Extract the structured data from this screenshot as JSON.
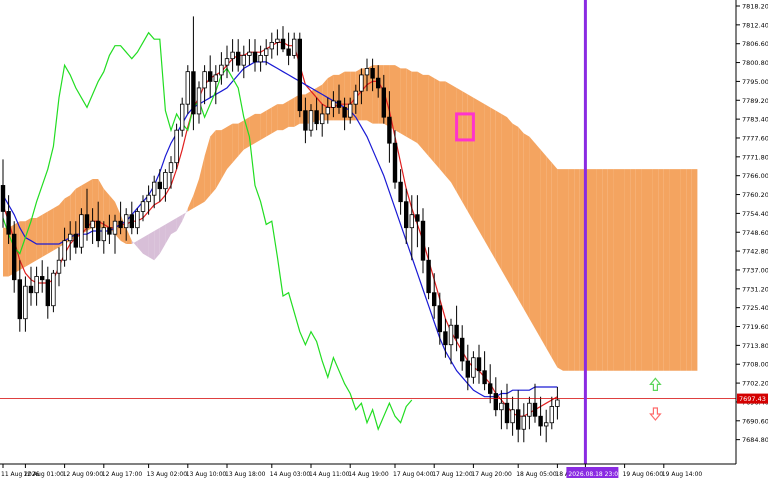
{
  "chart_data": {
    "type": "candlestick",
    "instrument_note": "",
    "y_axis": {
      "min": 7681.0,
      "max": 7818.2,
      "ticks": [
        "7818.20",
        "7812.40",
        "7806.60",
        "7800.80",
        "7795.00",
        "7789.20",
        "7783.40",
        "7777.60",
        "7771.80",
        "7766.00",
        "7760.20",
        "7754.40",
        "7748.60",
        "7742.80",
        "7737.00",
        "7731.20",
        "7725.40",
        "7719.60",
        "7713.80",
        "7708.00",
        "7702.20",
        "7696.40",
        "7690.60",
        "7684.80"
      ]
    },
    "x_axis": {
      "ticks": [
        {
          "label": "11 Aug 2026",
          "i": 0
        },
        {
          "label": "12 Aug 01:00",
          "i": 4
        },
        {
          "label": "12 Aug 09:00",
          "i": 11
        },
        {
          "label": "12 Aug 17:00",
          "i": 18
        },
        {
          "label": "13 Aug 02:00",
          "i": 26
        },
        {
          "label": "13 Aug 10:00",
          "i": 33
        },
        {
          "label": "13 Aug 18:00",
          "i": 40
        },
        {
          "label": "14 Aug 03:00",
          "i": 48
        },
        {
          "label": "14 Aug 11:00",
          "i": 55
        },
        {
          "label": "14 Aug 19:00",
          "i": 62
        },
        {
          "label": "17 Aug 04:00",
          "i": 70
        },
        {
          "label": "17 Aug 12:00",
          "i": 77
        },
        {
          "label": "17 Aug 20:00",
          "i": 84
        },
        {
          "label": "18 Aug 05:00",
          "i": 92
        },
        {
          "label": "18 Aug 13:00",
          "i": 99
        },
        {
          "label": "2026.08.18 23:00",
          "i": 104,
          "highlight": true
        },
        {
          "label": "19 Aug 06:00",
          "i": 111
        },
        {
          "label": "19 Aug 14:00",
          "i": 118
        }
      ]
    },
    "current_price": {
      "value": 7697.43,
      "label": "7697.43",
      "color": "#d40000"
    },
    "vertical_marker": {
      "i": 104,
      "color": "#8a2be2"
    },
    "highlight_box": {
      "i0": 81,
      "i1": 84,
      "y0": 7785.0,
      "y1": 7777.0,
      "color": "#ff33cc"
    },
    "arrows": [
      {
        "dir": "up",
        "i": 116.5,
        "y": 7701.5,
        "color": "#5cd65c"
      },
      {
        "dir": "down",
        "i": 116.5,
        "y": 7693.0,
        "color": "#ff6a6a"
      }
    ],
    "ohlc": [
      [
        7763,
        7771,
        7750,
        7755
      ],
      [
        7755,
        7760,
        7745,
        7748
      ],
      [
        7748,
        7752,
        7730,
        7734
      ],
      [
        7734,
        7740,
        7718,
        7722
      ],
      [
        7722,
        7735,
        7718,
        7732
      ],
      [
        7732,
        7738,
        7726,
        7730
      ],
      [
        7730,
        7738,
        7726,
        7735
      ],
      [
        7735,
        7740,
        7730,
        7734
      ],
      [
        7734,
        7738,
        7722,
        7726
      ],
      [
        7726,
        7737,
        7724,
        7736
      ],
      [
        7736,
        7744,
        7732,
        7740
      ],
      [
        7740,
        7750,
        7738,
        7746
      ],
      [
        7746,
        7752,
        7740,
        7748
      ],
      [
        7748,
        7752,
        7742,
        7744
      ],
      [
        7744,
        7756,
        7742,
        7754
      ],
      [
        7754,
        7762,
        7746,
        7750
      ],
      [
        7750,
        7756,
        7745,
        7752
      ],
      [
        7752,
        7758,
        7744,
        7746
      ],
      [
        7746,
        7752,
        7742,
        7750
      ],
      [
        7750,
        7754,
        7745,
        7748
      ],
      [
        7748,
        7754,
        7742,
        7752
      ],
      [
        7752,
        7758,
        7748,
        7750
      ],
      [
        7750,
        7756,
        7746,
        7754
      ],
      [
        7754,
        7758,
        7748,
        7750
      ],
      [
        7750,
        7756,
        7748,
        7755
      ],
      [
        7755,
        7760,
        7752,
        7758
      ],
      [
        7758,
        7763,
        7754,
        7760
      ],
      [
        7760,
        7766,
        7756,
        7764
      ],
      [
        7764,
        7768,
        7758,
        7762
      ],
      [
        7762,
        7768,
        7758,
        7767
      ],
      [
        7767,
        7772,
        7762,
        7770
      ],
      [
        7770,
        7782,
        7768,
        7780
      ],
      [
        7780,
        7790,
        7778,
        7788
      ],
      [
        7788,
        7800,
        7785,
        7798
      ],
      [
        7798,
        7815,
        7780,
        7785
      ],
      [
        7785,
        7795,
        7782,
        7793
      ],
      [
        7793,
        7800,
        7788,
        7798
      ],
      [
        7798,
        7803,
        7790,
        7795
      ],
      [
        7795,
        7800,
        7788,
        7797
      ],
      [
        7797,
        7804,
        7794,
        7800
      ],
      [
        7800,
        7806,
        7796,
        7802
      ],
      [
        7802,
        7808,
        7798,
        7804
      ],
      [
        7804,
        7808,
        7798,
        7800
      ],
      [
        7800,
        7806,
        7796,
        7803
      ],
      [
        7803,
        7808,
        7800,
        7804
      ],
      [
        7804,
        7808,
        7798,
        7801
      ],
      [
        7801,
        7806,
        7798,
        7803
      ],
      [
        7803,
        7808,
        7800,
        7805
      ],
      [
        7805,
        7810,
        7802,
        7807
      ],
      [
        7807,
        7811,
        7803,
        7808
      ],
      [
        7808,
        7812,
        7804,
        7805
      ],
      [
        7805,
        7810,
        7800,
        7803
      ],
      [
        7803,
        7810,
        7802,
        7808
      ],
      [
        7808,
        7810,
        7784,
        7786
      ],
      [
        7786,
        7790,
        7776,
        7780
      ],
      [
        7780,
        7788,
        7778,
        7786
      ],
      [
        7786,
        7790,
        7780,
        7782
      ],
      [
        7782,
        7788,
        7778,
        7785
      ],
      [
        7785,
        7790,
        7782,
        7787
      ],
      [
        7787,
        7792,
        7784,
        7789
      ],
      [
        7789,
        7794,
        7785,
        7787
      ],
      [
        7787,
        7790,
        7780,
        7784
      ],
      [
        7784,
        7790,
        7782,
        7788
      ],
      [
        7788,
        7794,
        7785,
        7792
      ],
      [
        7792,
        7799,
        7788,
        7797
      ],
      [
        7797,
        7802,
        7792,
        7799
      ],
      [
        7799,
        7802,
        7792,
        7796
      ],
      [
        7796,
        7800,
        7790,
        7793
      ],
      [
        7793,
        7797,
        7782,
        7784
      ],
      [
        7784,
        7792,
        7770,
        7776
      ],
      [
        7776,
        7780,
        7762,
        7764
      ],
      [
        7764,
        7768,
        7754,
        7758
      ],
      [
        7758,
        7762,
        7745,
        7750
      ],
      [
        7750,
        7760,
        7740,
        7754
      ],
      [
        7754,
        7760,
        7744,
        7752
      ],
      [
        7752,
        7756,
        7736,
        7740
      ],
      [
        7740,
        7744,
        7728,
        7730
      ],
      [
        7730,
        7736,
        7722,
        7726
      ],
      [
        7726,
        7730,
        7714,
        7718
      ],
      [
        7718,
        7722,
        7710,
        7714
      ],
      [
        7714,
        7722,
        7708,
        7720
      ],
      [
        7720,
        7726,
        7712,
        7716
      ],
      [
        7716,
        7720,
        7706,
        7709
      ],
      [
        7709,
        7714,
        7700,
        7704
      ],
      [
        7704,
        7712,
        7702,
        7710
      ],
      [
        7710,
        7714,
        7702,
        7706
      ],
      [
        7706,
        7712,
        7700,
        7702
      ],
      [
        7702,
        7708,
        7696,
        7699
      ],
      [
        7699,
        7704,
        7692,
        7694
      ],
      [
        7694,
        7700,
        7688,
        7696
      ],
      [
        7696,
        7702,
        7688,
        7690
      ],
      [
        7690,
        7698,
        7686,
        7694
      ],
      [
        7694,
        7700,
        7684,
        7688
      ],
      [
        7688,
        7696,
        7684,
        7692
      ],
      [
        7692,
        7698,
        7688,
        7696
      ],
      [
        7696,
        7702,
        7690,
        7692
      ],
      [
        7692,
        7698,
        7686,
        7689
      ],
      [
        7689,
        7694,
        7684,
        7690
      ],
      [
        7690,
        7698,
        7688,
        7695
      ],
      [
        7695,
        7701,
        7691,
        7697
      ]
    ],
    "series": [
      {
        "name": "",
        "color": "#e02020",
        "role": "tenkan",
        "values": [
          7757,
          7752,
          7746,
          7740,
          7736,
          7734,
          7733,
          7733,
          7733,
          7734,
          7738,
          7742,
          7745,
          7747,
          7748,
          7750,
          7752,
          7752,
          7751,
          7750,
          7750,
          7751,
          7751,
          7752,
          7752,
          7753,
          7755,
          7757,
          7758,
          7760,
          7763,
          7768,
          7774,
          7781,
          7787,
          7790,
          7794,
          7796,
          7797,
          7798,
          7800,
          7802,
          7803,
          7803,
          7804,
          7804,
          7804,
          7805,
          7806,
          7807,
          7807,
          7806,
          7806,
          7800,
          7794,
          7792,
          7790,
          7788,
          7787,
          7787,
          7788,
          7788,
          7788,
          7790,
          7792,
          7794,
          7795,
          7795,
          7792,
          7786,
          7778,
          7770,
          7762,
          7756,
          7751,
          7746,
          7740,
          7734,
          7728,
          7722,
          7718,
          7715,
          7712,
          7709,
          7707,
          7706,
          7704,
          7702,
          7699,
          7697,
          7695,
          7693,
          7692,
          7692,
          7693,
          7694,
          7695,
          7696,
          7697,
          7698
        ]
      },
      {
        "name": "",
        "color": "#1a1ad4",
        "role": "kijun",
        "values": [
          7760,
          7757,
          7754,
          7750,
          7747,
          7746,
          7745,
          7745,
          7745,
          7745,
          7745,
          7746,
          7747,
          7748,
          7748,
          7748,
          7749,
          7749,
          7749,
          7749,
          7750,
          7751,
          7752,
          7754,
          7756,
          7758,
          7760,
          7763,
          7767,
          7772,
          7776,
          7779,
          7782,
          7785,
          7787,
          7788,
          7789,
          7790,
          7791,
          7792,
          7793,
          7795,
          7797,
          7799,
          7800,
          7801,
          7801,
          7801,
          7800,
          7799,
          7798,
          7797,
          7796,
          7795,
          7794,
          7793,
          7792,
          7791,
          7790,
          7789,
          7788,
          7787,
          7786,
          7784,
          7781,
          7778,
          7774,
          7770,
          7766,
          7761,
          7756,
          7751,
          7746,
          7741,
          7736,
          7731,
          7726,
          7721,
          7716,
          7712,
          7709,
          7706,
          7704,
          7702,
          7700,
          7699,
          7698,
          7698,
          7698,
          7699,
          7699,
          7700,
          7700,
          7700,
          7700,
          7701,
          7701,
          7701,
          7701,
          7701
        ]
      },
      {
        "name": "",
        "color": "#22dd22",
        "role": "chikou",
        "values": [
          7753,
          7748,
          7744,
          7742,
          7747,
          7752,
          7758,
          7763,
          7768,
          7775,
          7790,
          7800,
          7797,
          7793,
          7790,
          7787,
          7791,
          7795,
          7798,
          7803,
          7806,
          7806,
          7804,
          7802,
          7804,
          7807,
          7810,
          7808,
          7808,
          7786,
          7780,
          7785,
          7782,
          7780,
          7787,
          7789,
          7784,
          7788,
          7792,
          7797,
          7799,
          7796,
          7793,
          7784,
          7778,
          7763,
          7758,
          7751,
          7752,
          7741,
          7729,
          7730,
          7724,
          7718,
          7714,
          7718,
          7715,
          7709,
          7704,
          7710,
          7706,
          7702,
          7699,
          7694,
          7696,
          7690,
          7694,
          7688,
          7692,
          7696,
          7692,
          7690,
          7695,
          7697
        ]
      }
    ],
    "cloud": {
      "start_i": 0,
      "span_a": [
        7750,
        7750,
        7751,
        7752,
        7752,
        7753,
        7753,
        7754,
        7755,
        7756,
        7757,
        7759,
        7760,
        7762,
        7763,
        7764,
        7765,
        7765,
        7762,
        7760,
        7758,
        7754,
        7750,
        7746,
        7744,
        7742,
        7741,
        7740,
        7742,
        7745,
        7748,
        7749,
        7752,
        7756,
        7760,
        7765,
        7772,
        7778,
        7780,
        7780,
        7781,
        7782,
        7782,
        7783,
        7784,
        7785,
        7785,
        7786,
        7787,
        7788,
        7788,
        7789,
        7790,
        7791,
        7791,
        7792,
        7793,
        7794,
        7796,
        7797,
        7797,
        7798,
        7798,
        7798,
        7799,
        7799,
        7800,
        7800,
        7800,
        7800,
        7800,
        7799,
        7799,
        7798,
        7798,
        7797,
        7797,
        7796,
        7795,
        7795,
        7794,
        7793,
        7792,
        7791,
        7790,
        7789,
        7788,
        7787,
        7786,
        7785,
        7784,
        7782,
        7781,
        7779,
        7778,
        7776,
        7774,
        7772,
        7770,
        7768,
        7768,
        7768,
        7768,
        7768,
        7768,
        7768,
        7768,
        7768,
        7768,
        7768,
        7768,
        7768,
        7768,
        7768,
        7768,
        7768,
        7768,
        7768,
        7768,
        7768,
        7768,
        7768,
        7768,
        7768,
        7768
      ],
      "span_b": [
        7735,
        7735,
        7736,
        7737,
        7738,
        7739,
        7740,
        7741,
        7742,
        7743,
        7744,
        7745,
        7746,
        7747,
        7748,
        7749,
        7750,
        7750,
        7750,
        7750,
        7748,
        7746,
        7745,
        7745,
        7746,
        7747,
        7748,
        7749,
        7750,
        7751,
        7752,
        7753,
        7754,
        7755,
        7756,
        7757,
        7758,
        7760,
        7762,
        7765,
        7768,
        7770,
        7772,
        7774,
        7775,
        7776,
        7777,
        7778,
        7779,
        7780,
        7780,
        7781,
        7781,
        7782,
        7782,
        7782,
        7783,
        7783,
        7783,
        7783,
        7783,
        7783,
        7783,
        7783,
        7783,
        7783,
        7782,
        7782,
        7782,
        7781,
        7780,
        7779,
        7778,
        7777,
        7776,
        7774,
        7772,
        7770,
        7768,
        7766,
        7764,
        7761,
        7758,
        7755,
        7752,
        7749,
        7746,
        7743,
        7740,
        7737,
        7734,
        7731,
        7728,
        7725,
        7722,
        7719,
        7716,
        7713,
        7710,
        7707,
        7706,
        7706,
        7706,
        7706,
        7706,
        7706,
        7706,
        7706,
        7706,
        7706,
        7706,
        7706,
        7706,
        7706,
        7706,
        7706,
        7706,
        7706,
        7706,
        7706,
        7706,
        7706,
        7706,
        7706,
        7706
      ]
    },
    "colors": {
      "bull_cloud": "#f4a460",
      "bear_cloud": "#d8bfd8",
      "candle": "#000000",
      "grid_text": "#000000"
    }
  }
}
